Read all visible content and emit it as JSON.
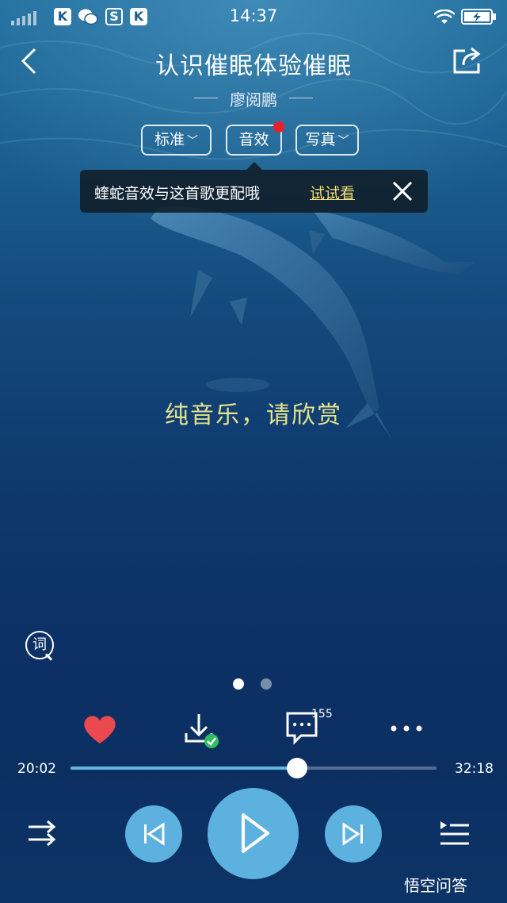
{
  "status_bar": {
    "time": "14:37",
    "badges": [
      "K",
      "S",
      "K"
    ]
  },
  "header": {
    "back_icon": "chevron-left-icon",
    "title": "认识催眠体验催眠",
    "artist": "廖阅鹏",
    "share_icon": "share-icon"
  },
  "chips": {
    "quality": "标准",
    "effects": "音效",
    "photo": "写真",
    "effects_badge_color": "#e8202e"
  },
  "tooltip": {
    "text": "蝰蛇音效与这首歌更配哦",
    "action": "试试看",
    "action_color": "#f3df72"
  },
  "lyric": {
    "text": "纯音乐，请欣赏",
    "color": "#e6e38c"
  },
  "lyric_button": {
    "label": "词"
  },
  "pager": {
    "count": 2,
    "active_index": 0
  },
  "actions": {
    "favorite_color": "#ea4a4f",
    "comment_count": "155"
  },
  "progress": {
    "current": "20:02",
    "total": "32:18",
    "fraction": 0.62,
    "accent": "#63b7e4"
  },
  "controls": {
    "button_color": "#5cb1df"
  },
  "watermark": {
    "text": "悟空问答"
  }
}
